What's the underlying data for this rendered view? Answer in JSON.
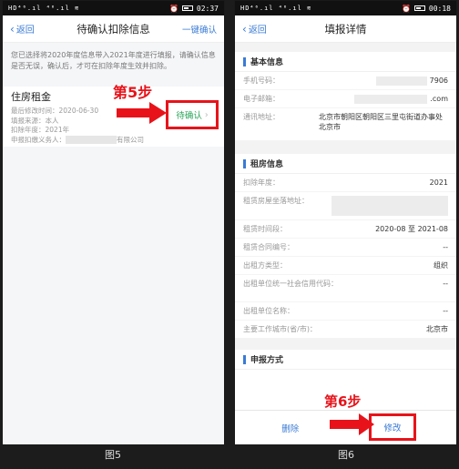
{
  "screen5": {
    "status": {
      "signal": "HD⁴⁶.ıl ⁴⁶.ıl ≋",
      "time": "02:37"
    },
    "nav": {
      "back": "返回",
      "title": "待确认扣除信息",
      "action": "一键确认"
    },
    "notice": "您已选择将2020年度信息带入2021年度进行填报，请确认信息是否无误，确认后，才可在扣除年度生效并扣除。",
    "card": {
      "title": "住房租金",
      "lines": [
        {
          "label": "最后修改时间：",
          "value": "2020-06-30"
        },
        {
          "label": "填报来源：",
          "value": "本人"
        },
        {
          "label": "扣除年度：",
          "value": "2021年"
        },
        {
          "label": "申报扣缴义务人：",
          "suffix": "有限公司"
        }
      ],
      "status": "待确认"
    },
    "step_label": "第5步",
    "caption": "图5"
  },
  "screen6": {
    "status": {
      "signal": "HD⁴⁶.ıl ⁴⁶.ıl ≋",
      "time": "00:18"
    },
    "nav": {
      "back": "返回",
      "title": "填报详情"
    },
    "basic": {
      "title": "基本信息",
      "rows": [
        {
          "label": "手机号码：",
          "value": "7906"
        },
        {
          "label": "电子邮箱：",
          "value": ".com"
        },
        {
          "label": "通讯地址：",
          "value": "北京市朝阳区朝阳区三里屯街道办事处北京市"
        }
      ]
    },
    "rent": {
      "title": "租房信息",
      "rows": [
        {
          "label": "扣除年度：",
          "value": "2021"
        },
        {
          "label": "租赁房屋坐落地址：",
          "value": ""
        },
        {
          "label": "租赁时间段：",
          "value": "2020-08 至 2021-08"
        },
        {
          "label": "租赁合同编号：",
          "value": "--"
        },
        {
          "label": "出租方类型：",
          "value": "组织"
        },
        {
          "label": "出租单位统一社会信用代码：",
          "value": "--"
        },
        {
          "label": "出租单位名称：",
          "value": "--"
        },
        {
          "label": "主要工作城市(省/市)：",
          "value": "北京市"
        }
      ]
    },
    "declare": {
      "title": "申报方式"
    },
    "bottom": {
      "delete": "删除",
      "modify": "修改"
    },
    "step_label": "第6步",
    "caption": "图6"
  },
  "colors": {
    "accent": "#3a7bd5",
    "highlight": "#e8131a",
    "confirm": "#2aa55a"
  }
}
